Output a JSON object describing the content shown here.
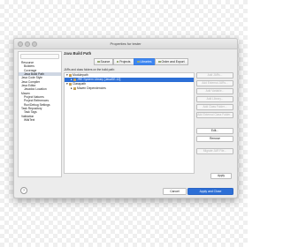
{
  "window": {
    "title": "Properties for tester"
  },
  "sidebar": {
    "items": [
      {
        "label": "Resource",
        "child": false,
        "selected": false
      },
      {
        "label": "Builders",
        "child": true,
        "selected": false
      },
      {
        "label": "Coverage",
        "child": true,
        "selected": false
      },
      {
        "label": "Java Build Path",
        "child": true,
        "selected": true
      },
      {
        "label": "Java Code Style",
        "child": false,
        "selected": false
      },
      {
        "label": "Java Compiler",
        "child": false,
        "selected": false
      },
      {
        "label": "Java Editor",
        "child": false,
        "selected": false
      },
      {
        "label": "Javadoc Location",
        "child": true,
        "selected": false
      },
      {
        "label": "Maven",
        "child": false,
        "selected": false
      },
      {
        "label": "Project Natures",
        "child": true,
        "selected": false
      },
      {
        "label": "Project References",
        "child": true,
        "selected": false
      },
      {
        "label": "Run/Debug Settings",
        "child": true,
        "selected": false
      },
      {
        "label": "Task Repository",
        "child": false,
        "selected": false
      },
      {
        "label": "Task Tags",
        "child": true,
        "selected": false
      },
      {
        "label": "Validation",
        "child": false,
        "selected": false
      },
      {
        "label": "WikiText",
        "child": true,
        "selected": false
      }
    ]
  },
  "main": {
    "heading": "Java Build Path",
    "tabs": [
      "Source",
      "Projects",
      "Libraries",
      "Order and Export"
    ],
    "active_tab": "Libraries",
    "description": "JARs and class folders on the build path:",
    "tree": [
      {
        "label": "Modulepath",
        "indent": 0,
        "expanded": true,
        "selected": false
      },
      {
        "label": "JRE System Library [JavaSE-12]",
        "indent": 1,
        "selected": true
      },
      {
        "label": "Classpath",
        "indent": 0,
        "expanded": true,
        "selected": false
      },
      {
        "label": "Maven Dependencies",
        "indent": 1,
        "selected": false
      }
    ],
    "buttons": [
      {
        "label": "Add JARs...",
        "disabled": true
      },
      {
        "label": "Add External JARs...",
        "disabled": true
      },
      {
        "label": "Add Variable...",
        "disabled": true
      },
      {
        "label": "Add Library...",
        "disabled": true
      },
      {
        "label": "Add Class Folder...",
        "disabled": true
      },
      {
        "label": "Add External Class Folder...",
        "disabled": true
      },
      {
        "label": "Edit...",
        "disabled": false
      },
      {
        "label": "Remove",
        "disabled": false
      },
      {
        "label": "Migrate JAR File...",
        "disabled": true
      }
    ],
    "apply_label": "Apply"
  },
  "footer": {
    "help_label": "?",
    "cancel_label": "Cancel",
    "apply_close_label": "Apply and Close"
  }
}
